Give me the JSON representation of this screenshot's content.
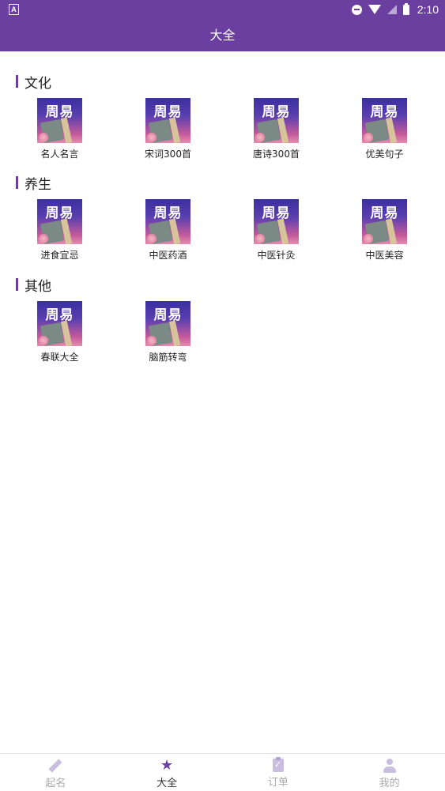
{
  "status_bar": {
    "left_icon": "A",
    "time": "2:10",
    "icons": [
      "dnd-icon",
      "wifi-icon",
      "signal-icon",
      "battery-icon"
    ]
  },
  "app_bar": {
    "title": "大全"
  },
  "thumbnail_text": "周易",
  "sections": [
    {
      "title": "文化",
      "items": [
        "名人名言",
        "宋词300首",
        "唐诗300首",
        "优美句子"
      ]
    },
    {
      "title": "养生",
      "items": [
        "进食宜忌",
        "中医药酒",
        "中医针灸",
        "中医美容"
      ]
    },
    {
      "title": "其他",
      "items": [
        "春联大全",
        "脑筋转弯"
      ]
    }
  ],
  "bottom_nav": [
    {
      "label": "起名",
      "icon": "pen-icon",
      "active": false
    },
    {
      "label": "大全",
      "icon": "star-icon",
      "active": true
    },
    {
      "label": "订单",
      "icon": "clipboard-icon",
      "active": false
    },
    {
      "label": "我的",
      "icon": "person-icon",
      "active": false
    }
  ],
  "colors": {
    "primary": "#6a3fa0",
    "inactive": "#aaaaaa",
    "active_text": "#333333"
  }
}
